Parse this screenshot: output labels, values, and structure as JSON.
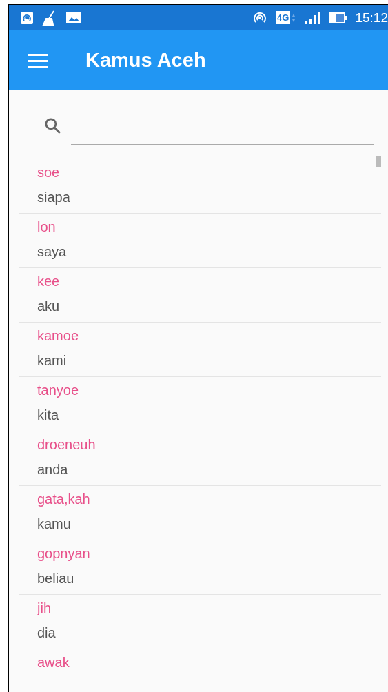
{
  "status_bar": {
    "network_type": "4G",
    "time": "15:12"
  },
  "toolbar": {
    "title": "Kamus Aceh"
  },
  "entries": [
    {
      "word": "soe",
      "meaning": "siapa"
    },
    {
      "word": "lon",
      "meaning": "saya"
    },
    {
      "word": "kee",
      "meaning": "aku"
    },
    {
      "word": "kamoe",
      "meaning": "kami"
    },
    {
      "word": "tanyoe",
      "meaning": "kita"
    },
    {
      "word": "droeneuh",
      "meaning": "anda"
    },
    {
      "word": "gata,kah",
      "meaning": "kamu"
    },
    {
      "word": "gopnyan",
      "meaning": "beliau"
    },
    {
      "word": "jih",
      "meaning": "dia"
    },
    {
      "word": "awak"
    }
  ]
}
